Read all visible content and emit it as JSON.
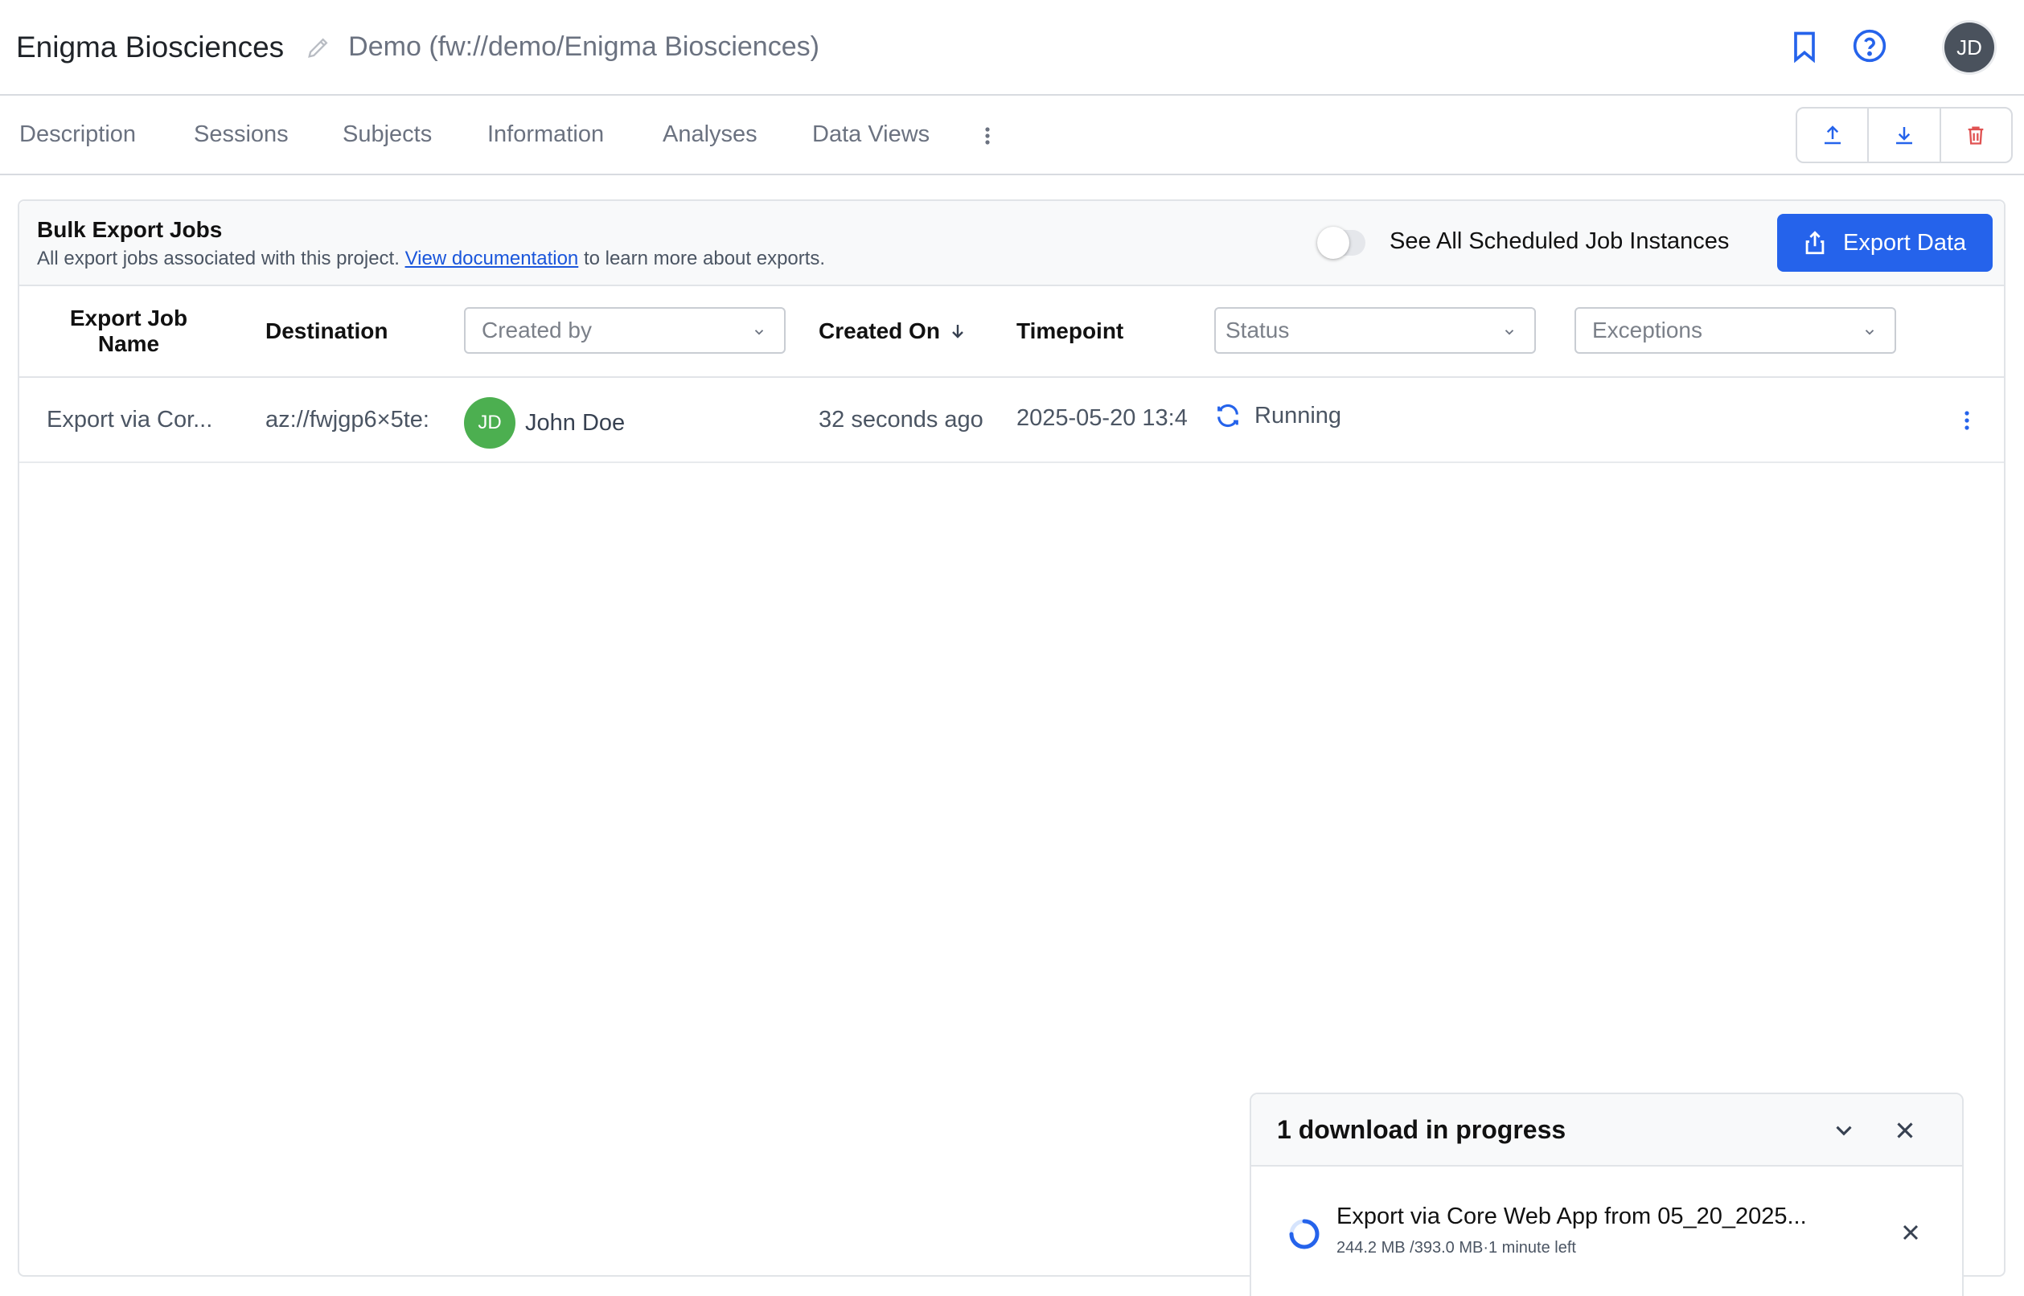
{
  "header": {
    "project_title": "Enigma Biosciences",
    "project_path": "Demo (fw://demo/Enigma Biosciences)",
    "user_initials": "JD"
  },
  "tabs": [
    {
      "label": "Description"
    },
    {
      "label": "Sessions"
    },
    {
      "label": "Subjects"
    },
    {
      "label": "Information"
    },
    {
      "label": "Analyses"
    },
    {
      "label": "Data Views"
    }
  ],
  "panel": {
    "title": "Bulk Export Jobs",
    "subtitle_prefix": "All export jobs associated with this project.",
    "doc_link": "View documentation",
    "subtitle_suffix": "to learn more about exports.",
    "toggle_label": "See All Scheduled Job Instances",
    "toggle_on": false,
    "export_button": "Export Data"
  },
  "table": {
    "headers": {
      "name": "Export Job Name",
      "destination": "Destination",
      "created_by_placeholder": "Created by",
      "created_on": "Created On",
      "timepoint": "Timepoint",
      "status_placeholder": "Status",
      "exceptions_placeholder": "Exceptions"
    },
    "rows": [
      {
        "name": "Export via Cor...",
        "destination": "az://fwjgp6×5te:",
        "user_initials": "JD",
        "user_name": "John Doe",
        "created_on": "32 seconds ago",
        "timepoint": "2025-05-20 13:4",
        "status": "Running"
      }
    ]
  },
  "downloads": {
    "title": "1 download in progress",
    "items": [
      {
        "name": "Export via Core Web App from 05_20_2025...",
        "meta": "244.2 MB /393.0 MB·1 minute left"
      }
    ]
  },
  "colors": {
    "accent": "#2563eb",
    "danger": "#e05252",
    "avatar_green": "#4caf50"
  }
}
